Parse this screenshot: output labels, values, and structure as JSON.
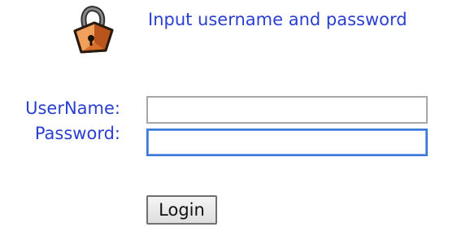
{
  "login": {
    "prompt": "Input username and password",
    "icon": "lock-icon",
    "username_label": "UserName:",
    "username_value": "",
    "password_label": "Password:",
    "password_value": "",
    "login_button": "Login"
  },
  "colors": {
    "label_text": "#2a3fd0",
    "focus_border": "#3b78d8"
  }
}
